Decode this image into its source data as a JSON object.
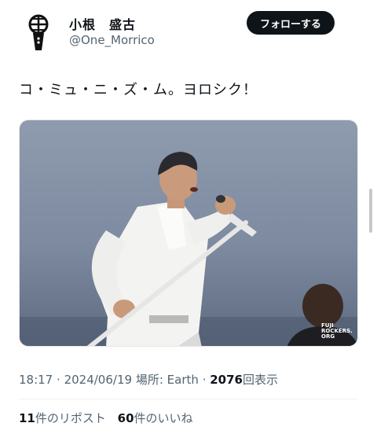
{
  "author": {
    "display_name": "小根　盛古",
    "handle": "@One_Morrico",
    "avatar_icon": "microphone-icon"
  },
  "follow_button": {
    "label": "フォローする"
  },
  "tweet": {
    "text": "コ・ミュ・ニ・ズ・ム。ヨロシク！",
    "media": {
      "watermark": "FUJI\nROCKERS.\nORG"
    }
  },
  "meta": {
    "time": "18:17",
    "separator": "·",
    "date": "2024/06/19",
    "place_label": "場所:",
    "place": "Earth",
    "views_count": "2076",
    "views_label": "回表示"
  },
  "stats": {
    "reposts_count": "11",
    "reposts_label": "件のリポスト",
    "likes_count": "60",
    "likes_label": "件のいいね"
  },
  "colors": {
    "text_primary": "#0f1419",
    "text_secondary": "#536471",
    "follow_button_bg": "#0f1419",
    "divider": "#eff3f4"
  }
}
